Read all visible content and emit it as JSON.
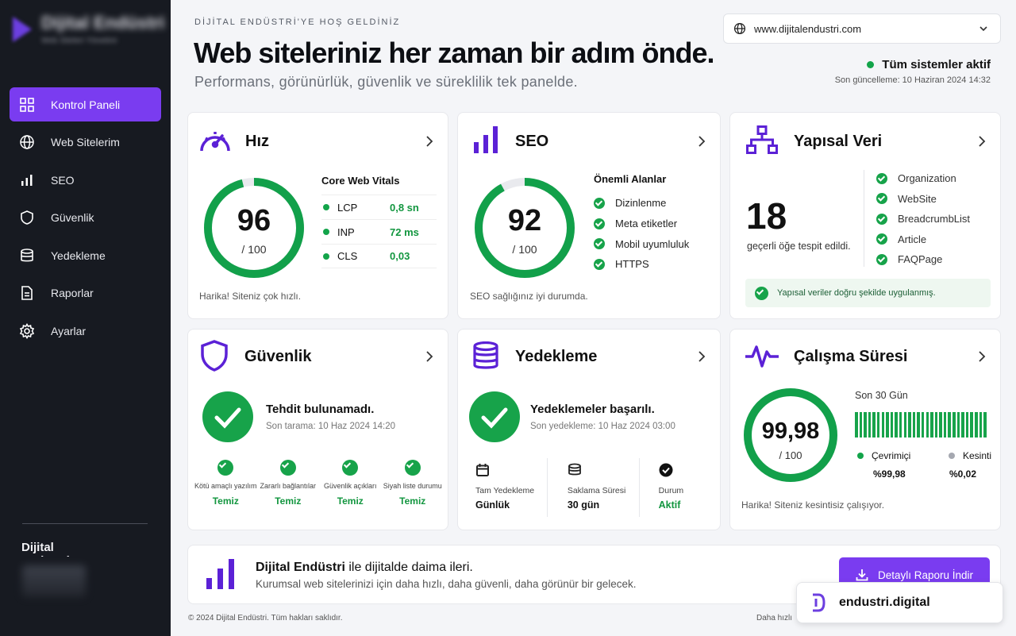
{
  "sidebar": {
    "logo_text": "Dijital Endüstri",
    "logo_sub": "Web Siteleri Yönetimi",
    "items": [
      {
        "label": "Kontrol Paneli",
        "icon": "grid-icon"
      },
      {
        "label": "Web Sitelerim",
        "icon": "globe-icon"
      },
      {
        "label": "SEO",
        "icon": "bar-chart-icon"
      },
      {
        "label": "Güvenlik",
        "icon": "shield-icon"
      },
      {
        "label": "Yedekleme",
        "icon": "database-icon"
      },
      {
        "label": "Raporlar",
        "icon": "document-icon"
      },
      {
        "label": "Ayarlar",
        "icon": "gear-icon"
      }
    ],
    "brand": "Dijital Endüstri"
  },
  "header": {
    "welcome": "DİJİTAL ENDÜSTRİ'YE HOŞ GELDİNİZ",
    "title": "Web siteleriniz her zaman bir adım önde.",
    "subtitle": "Performans, görünürlük, güvenlik ve süreklilik tek panelde.",
    "domain": "www.dijitalendustri.com",
    "status": "Tüm sistemler aktif",
    "last_update": "Son güncelleme: 10 Haziran 2024 14:32"
  },
  "speed": {
    "title": "Hız",
    "score": "96",
    "max": "/ 100",
    "score_value": 96,
    "vitals_title": "Core Web Vitals",
    "vitals": [
      {
        "name": "LCP",
        "value": "0,8 sn"
      },
      {
        "name": "INP",
        "value": "72 ms"
      },
      {
        "name": "CLS",
        "value": "0,03"
      }
    ],
    "note": "Harika! Siteniz çok hızlı."
  },
  "seo": {
    "title": "SEO",
    "score": "92",
    "max": "/ 100",
    "score_value": 92,
    "areas_title": "Önemli Alanlar",
    "areas": [
      "Dizinlenme",
      "Meta etiketler",
      "Mobil uyumluluk",
      "HTTPS"
    ],
    "note": "SEO sağlığınız iyi durumda."
  },
  "structured": {
    "title": "Yapısal Veri",
    "count": "18",
    "count_label": "geçerli öğe tespit edildi.",
    "items": [
      "Organization",
      "WebSite",
      "BreadcrumbList",
      "Article",
      "FAQPage"
    ],
    "banner": "Yapısal veriler doğru şekilde uygulanmış."
  },
  "security": {
    "title": "Güvenlik",
    "headline": "Tehdit bulunamadı.",
    "last_scan": "Son tarama: 10 Haz 2024 14:20",
    "checks": [
      {
        "label": "Kötü amaçlı yazılım",
        "value": "Temiz"
      },
      {
        "label": "Zararlı bağlantılar",
        "value": "Temiz"
      },
      {
        "label": "Güvenlik açıkları",
        "value": "Temiz"
      },
      {
        "label": "Siyah liste durumu",
        "value": "Temiz"
      }
    ]
  },
  "backup": {
    "title": "Yedekleme",
    "headline": "Yedeklemeler başarılı.",
    "last_backup": "Son yedekleme: 10 Haz 2024 03:00",
    "stats": [
      {
        "label": "Tam Yedekleme",
        "value": "Günlük",
        "icon": "calendar-icon"
      },
      {
        "label": "Saklama Süresi",
        "value": "30 gün",
        "icon": "layers-icon"
      },
      {
        "label": "Durum",
        "value": "Aktif",
        "icon": "check-circle-icon"
      }
    ]
  },
  "uptime": {
    "title": "Çalışma Süresi",
    "score": "99,98",
    "max": "/ 100",
    "score_value": 99.98,
    "period": "Son 30 Gün",
    "online_label": "Çevrimiçi",
    "online_value": "%99,98",
    "down_label": "Kesinti",
    "down_value": "%0,02",
    "note": "Harika! Siteniz kesintisiz çalışıyor."
  },
  "promo": {
    "brand": "Dijital Endüstri",
    "tagline": " ile dijitalde daima ileri.",
    "description": "Kurumsal web sitelerinizi için daha hızlı, daha güvenli, daha görünür bir gelecek.",
    "button": "Detaylı Raporu İndir"
  },
  "footer": {
    "copyright": "© 2024 Dijital Endüstri. Tüm hakları saklıdır.",
    "right": "Daha hızlı",
    "badge": "endustri.digital"
  },
  "colors": {
    "accent": "#7a3cf0",
    "success": "#17a34a",
    "sidebar": "#171a21"
  }
}
